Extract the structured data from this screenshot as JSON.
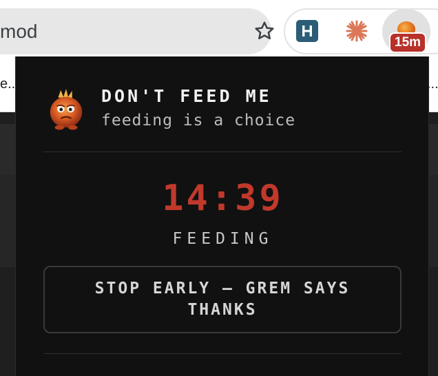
{
  "browser": {
    "address_text": "mod",
    "bookmark_left": "e...",
    "bookmark_right": "...",
    "extensions": [
      {
        "icon": "hashnode-icon"
      },
      {
        "icon": "claude-asterisk-icon"
      },
      {
        "icon": "gremlin-avatar-icon",
        "badge": "15m"
      }
    ],
    "badge_color": "#b8312a"
  },
  "popup": {
    "title": "DON'T FEED ME",
    "subtitle": "feeding is a choice",
    "avatar_icon": "gremlin-avatar-icon",
    "timer": "14:39",
    "status": "FEEDING",
    "stop_button_label": "STOP EARLY — GREM SAYS THANKS",
    "colors": {
      "background": "#111111",
      "timer": "#c0392b",
      "title": "#f2f2f2"
    }
  }
}
